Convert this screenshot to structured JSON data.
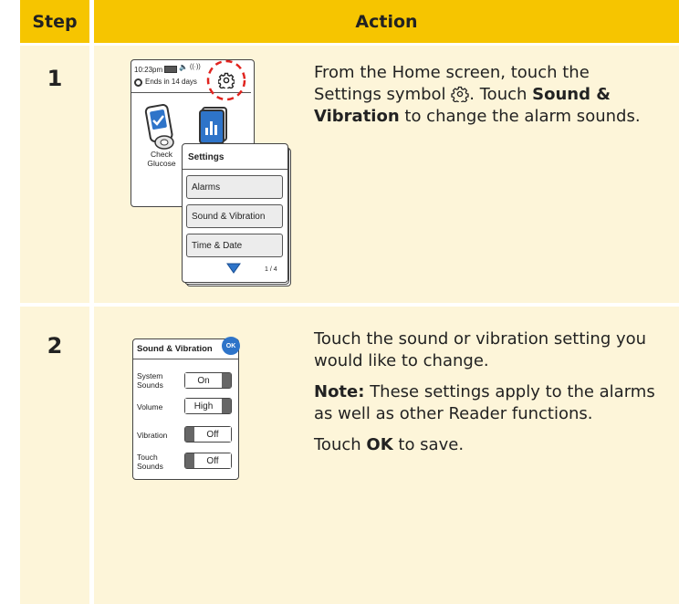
{
  "header": {
    "step": "Step",
    "action": "Action"
  },
  "rows": [
    {
      "step": "1",
      "device": {
        "time": "10:23pm",
        "ends": "Ends in 14 days",
        "check_label_1": "Check",
        "check_label_2": "Glucose",
        "settings_title": "Settings",
        "menu": [
          "Alarms",
          "Sound & Vibration",
          "Time & Date"
        ],
        "page": "1 / 4"
      },
      "text": {
        "l1": "From the Home screen, touch the",
        "l2a": "Settings symbol",
        "l2b": ". Touch",
        "l2c": "Sound &",
        "l3a": "Vibration",
        "l3b": "to change the alarm sounds."
      }
    },
    {
      "step": "2",
      "device": {
        "title": "Sound & Vibration",
        "ok": "OK",
        "settings": [
          {
            "label1": "System",
            "label2": "Sounds",
            "value": "On"
          },
          {
            "label1": "Volume",
            "label2": "",
            "value": "High"
          },
          {
            "label1": "Vibration",
            "label2": "",
            "value": "Off"
          },
          {
            "label1": "Touch",
            "label2": "Sounds",
            "value": "Off"
          }
        ]
      },
      "text": {
        "p1a": "Touch the sound or vibration setting you",
        "p1b": "would like to change.",
        "note_label": "Note:",
        "p2a": "These settings apply to the alarms",
        "p2b": "as well as other Reader functions.",
        "p3a": "Touch",
        "p3b": "OK",
        "p3c": "to save."
      }
    }
  ],
  "colors": {
    "header": "#f6c500",
    "cell": "#fdf5d9",
    "accent_blue": "#2e74c9"
  }
}
